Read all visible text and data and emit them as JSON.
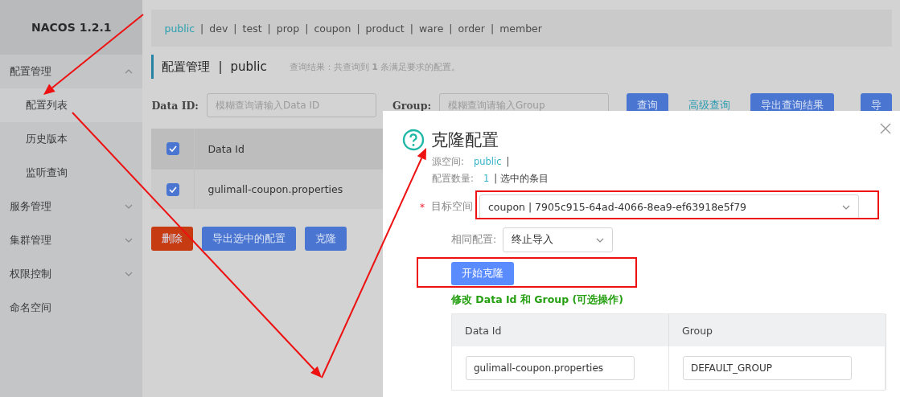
{
  "sidebar": {
    "title": "NACOS 1.2.1",
    "items": [
      {
        "label": "配置管理",
        "kind": "group",
        "expanded": true,
        "children": [
          {
            "label": "配置列表",
            "selected": true
          },
          {
            "label": "历史版本",
            "selected": false
          },
          {
            "label": "监听查询",
            "selected": false
          }
        ]
      },
      {
        "label": "服务管理",
        "kind": "group",
        "expanded": false
      },
      {
        "label": "集群管理",
        "kind": "group",
        "expanded": false
      },
      {
        "label": "权限控制",
        "kind": "group",
        "expanded": false
      },
      {
        "label": "命名空间",
        "kind": "link"
      }
    ]
  },
  "namespaces": [
    {
      "label": "public",
      "selected": true
    },
    {
      "separator": "|",
      "label": "dev",
      "selected": false
    },
    {
      "separator": "|",
      "label": "test",
      "selected": false
    },
    {
      "separator": "|",
      "label": "prop",
      "selected": false
    },
    {
      "separator": "|",
      "label": "coupon",
      "selected": false
    },
    {
      "separator": "|",
      "label": "product",
      "selected": false
    },
    {
      "separator": "|",
      "label": "ware",
      "selected": false
    },
    {
      "separator": "|",
      "label": "order",
      "selected": false
    },
    {
      "separator": "|",
      "label": "member",
      "selected": false
    }
  ],
  "page_title": {
    "section": "配置管理",
    "separator": "|",
    "namespace": "public",
    "summary": "查询结果：共查询到 **1** 条满足要求的配置。"
  },
  "search": {
    "fields": [
      {
        "label": "Data ID:",
        "placeholder": "模糊查询请输入Data ID"
      },
      {
        "label": "Group:",
        "placeholder": "模糊查询请输入Group"
      }
    ],
    "buttons": [
      {
        "label": "查询",
        "kind": "primary"
      },
      {
        "label": "高级查询",
        "kind": "link"
      },
      {
        "label": "导出查询结果",
        "kind": "primary"
      },
      {
        "label": "导",
        "kind": "primary"
      }
    ]
  },
  "table": {
    "all_checked": true,
    "columns": [
      "Data Id"
    ],
    "rows": [
      {
        "checked": true,
        "data_id": "gulimall-coupon.properties"
      }
    ]
  },
  "actions": [
    {
      "label": "删除",
      "kind": "danger"
    },
    {
      "label": "导出选中的配置",
      "kind": "primary"
    },
    {
      "label": "克隆",
      "kind": "primary"
    }
  ],
  "dialog": {
    "title": "克隆配置",
    "source_label": "源空间:",
    "source": "public",
    "source_sep": "|",
    "count_label": "配置数量:",
    "count": "1",
    "count_note": "| 选中的条目",
    "target": {
      "required_mark": "*",
      "label": "目标空间",
      "value": "coupon | 7905c915-64ad-4066-8ea9-ef63918e5f79"
    },
    "same": {
      "label": "相同配置:",
      "value": "终止导入"
    },
    "start_button": "开始克隆",
    "note": "修改 Data Id 和 Group (可选操作)",
    "columns": [
      "Data Id",
      "Group"
    ],
    "rows": [
      {
        "data_id": "gulimall-coupon.properties",
        "group": "DEFAULT_GROUP"
      }
    ]
  }
}
